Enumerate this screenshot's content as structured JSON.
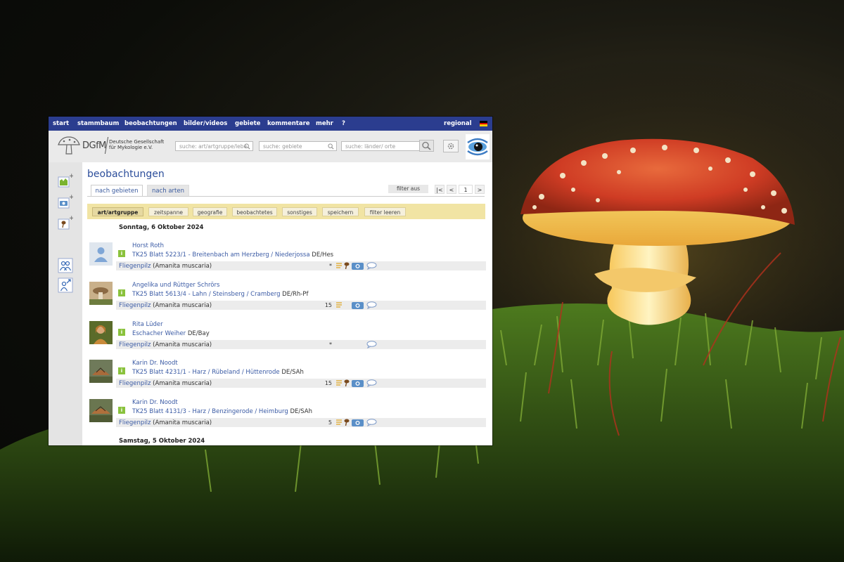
{
  "topnav": {
    "items": [
      "start",
      "stammbaum",
      "beobachtungen",
      "bilder/videos",
      "gebiete",
      "kommentare",
      "mehr",
      "?"
    ],
    "regional": "regional"
  },
  "header": {
    "logo_text": "DGfM",
    "logo_sub": "Deutsche Gesellschaft für Mykologie e.V.",
    "search_species": "suche: art/artgruppe/lebe",
    "search_areas": "suche: gebiete",
    "search_countries": "suche: länder/ orte"
  },
  "main": {
    "title": "beobachtungen",
    "tabs": [
      "nach gebieten",
      "nach arten"
    ],
    "filter_off": "filter aus",
    "pager": [
      "|<",
      "<",
      "1",
      ">"
    ],
    "filters": [
      "art/artgruppe",
      "zeitspanne",
      "geografie",
      "beobachtetes",
      "sonstiges",
      "speichern",
      "filter leeren"
    ]
  },
  "dates": [
    "Sonntag, 6 Oktober 2024",
    "Samstag, 5 Oktober 2024"
  ],
  "entries": [
    {
      "observer": "Horst Roth",
      "location": "TK25 Blatt 5223/1 - Breitenbach am Herzberg / Niederjossa",
      "region": "DE/Hes",
      "species_de": "Fliegenpilz",
      "species_lat": "(Amanita muscaria)",
      "count": "*",
      "icons": [
        "list-icon",
        "mushroom-icon",
        "camera-icon",
        "comment-icon"
      ]
    },
    {
      "observer": "Angelika und Rüttger Schrörs",
      "location": "TK25 Blatt 5613/4 - Lahn / Steinsberg / Cramberg",
      "region": "DE/Rh-Pf",
      "species_de": "Fliegenpilz",
      "species_lat": "(Amanita muscaria)",
      "count": "15",
      "icons": [
        "list-icon",
        "camera-icon",
        "comment-icon"
      ]
    },
    {
      "observer": "Rita Lüder",
      "location": "Eschacher Weiher",
      "region": "DE/Bay",
      "species_de": "Fliegenpilz",
      "species_lat": "(Amanita muscaria)",
      "count": "*",
      "icons": [
        "comment-icon"
      ]
    },
    {
      "observer": "Karin Dr. Noodt",
      "location": "TK25 Blatt 4231/1 - Harz / Rübeland / Hüttenrode",
      "region": "DE/SAh",
      "species_de": "Fliegenpilz",
      "species_lat": "(Amanita muscaria)",
      "count": "15",
      "icons": [
        "list-icon",
        "mushroom-icon",
        "camera-icon",
        "comment-icon"
      ]
    },
    {
      "observer": "Karin Dr. Noodt",
      "location": "TK25 Blatt 4131/3 - Harz / Benzingerode / Heimburg",
      "region": "DE/SAh",
      "species_de": "Fliegenpilz",
      "species_lat": "(Amanita muscaria)",
      "count": "5",
      "icons": [
        "list-icon",
        "mushroom-icon",
        "camera-icon",
        "comment-icon"
      ]
    }
  ],
  "colors": {
    "nav": "#2b3d8f",
    "link": "#3b5ba5",
    "filterbar": "#f1e4a4",
    "badge": "#8ac23d",
    "mushroom_cap": "#d6482a"
  }
}
